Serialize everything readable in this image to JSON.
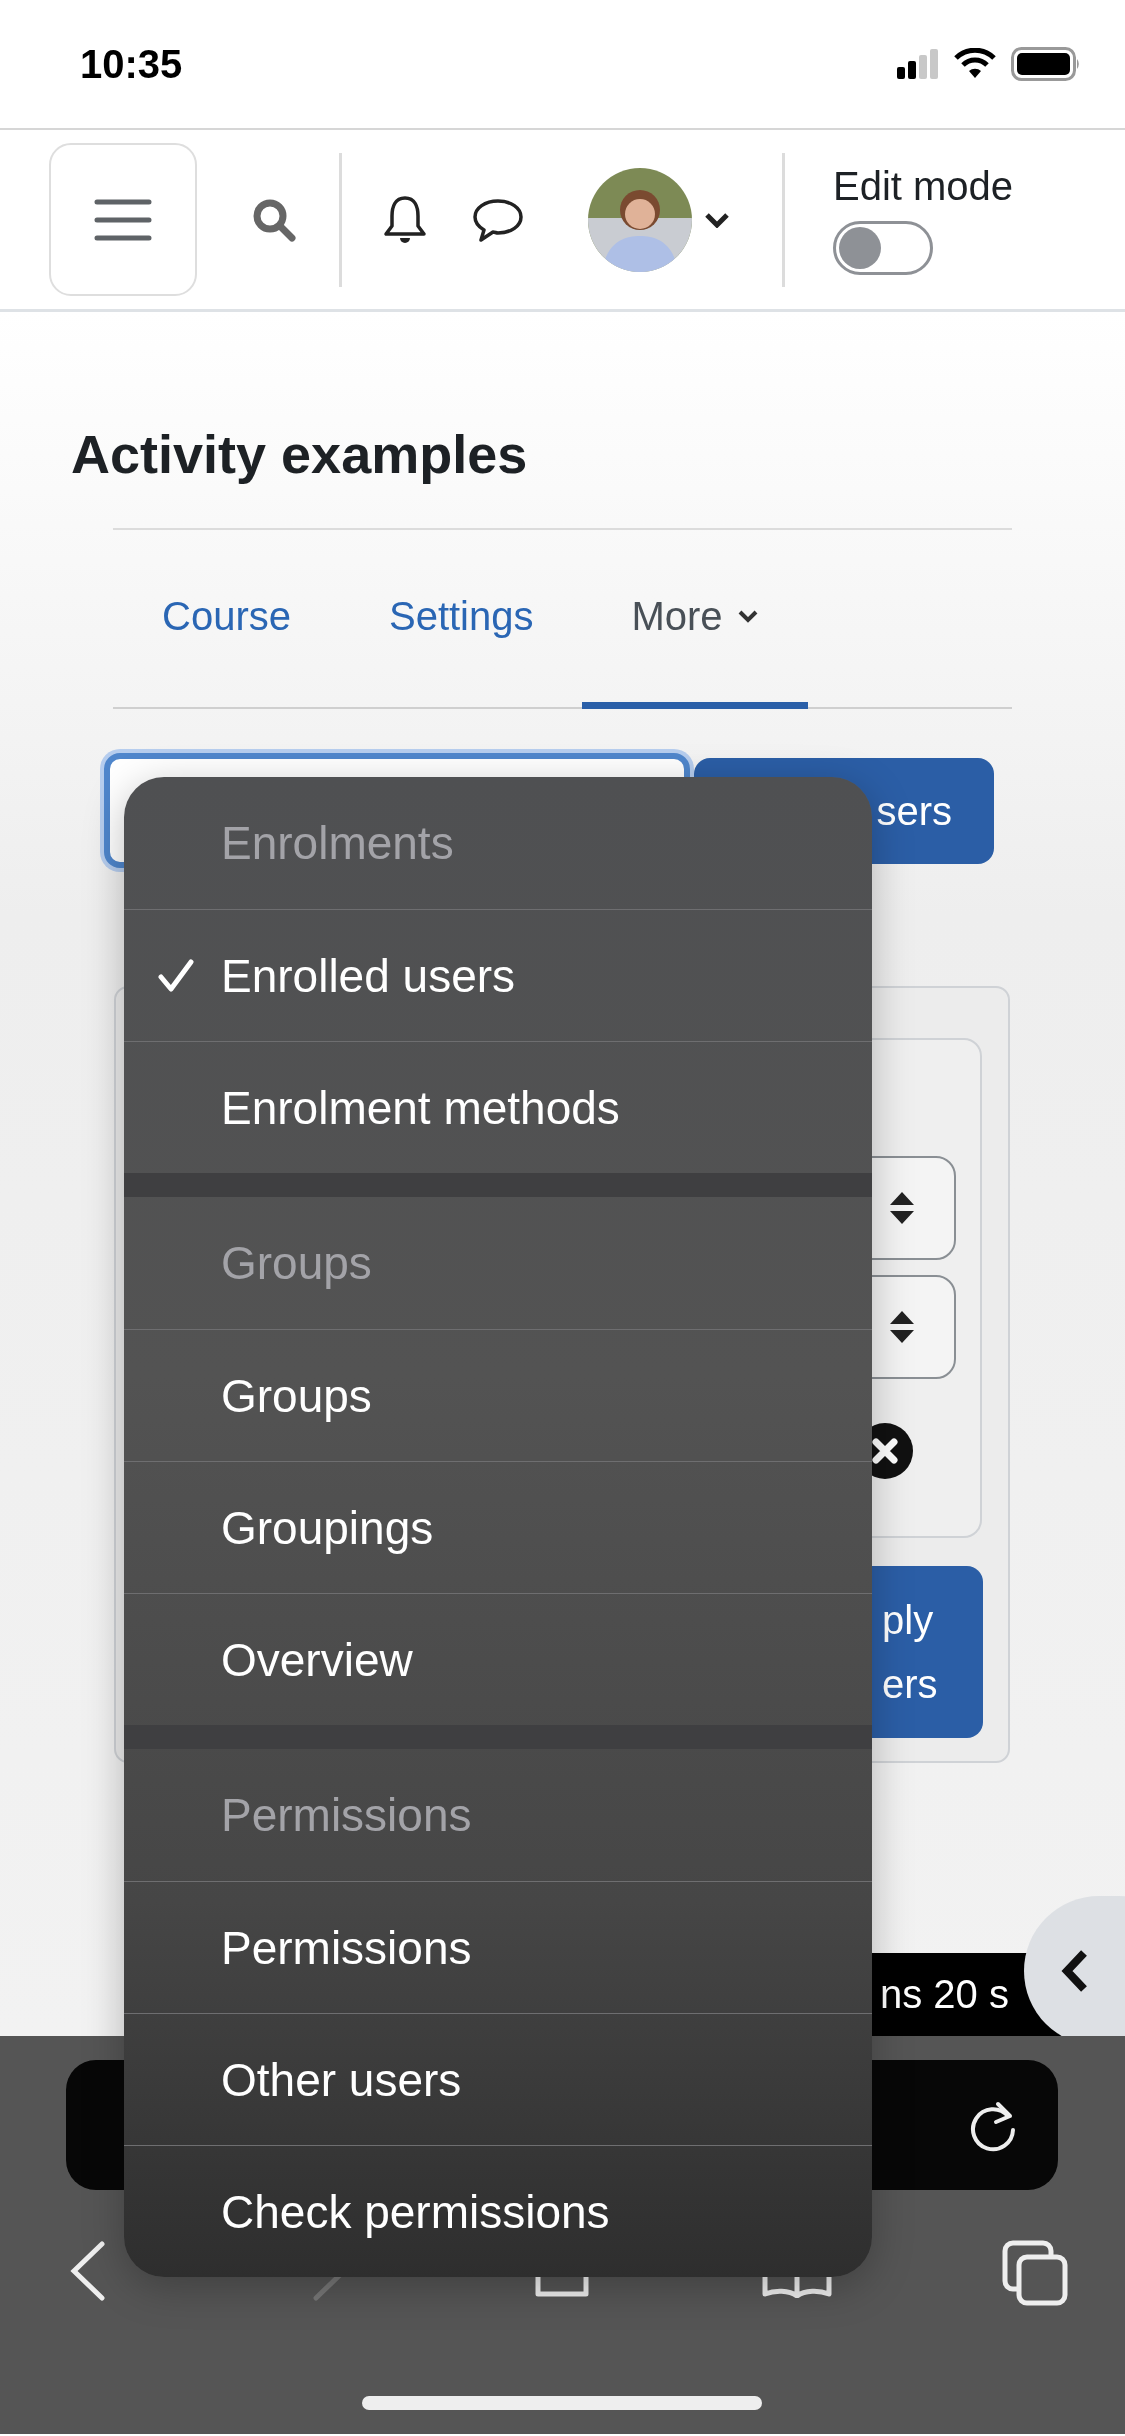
{
  "status_bar": {
    "time": "10:35"
  },
  "header": {
    "edit_mode": {
      "label": "Edit mode",
      "on": false
    }
  },
  "page": {
    "title": "Activity examples",
    "tabs": [
      {
        "label": "Course",
        "kind": "link",
        "selected": false
      },
      {
        "label": "Settings",
        "kind": "link",
        "selected": false
      },
      {
        "label": "More",
        "kind": "dropdown",
        "selected": true
      }
    ]
  },
  "background": {
    "enrol_button": "sers",
    "apply_button": "ply ers",
    "notice": "ns 20 s"
  },
  "select_menu": {
    "groups": [
      {
        "header": "Enrolments",
        "items": [
          {
            "label": "Enrolled users",
            "selected": true
          },
          {
            "label": "Enrolment methods",
            "selected": false
          }
        ]
      },
      {
        "header": "Groups",
        "items": [
          {
            "label": "Groups",
            "selected": false
          },
          {
            "label": "Groupings",
            "selected": false
          },
          {
            "label": "Overview",
            "selected": false
          }
        ]
      },
      {
        "header": "Permissions",
        "items": [
          {
            "label": "Permissions",
            "selected": false
          },
          {
            "label": "Other users",
            "selected": false
          },
          {
            "label": "Check permissions",
            "selected": false
          }
        ]
      }
    ]
  }
}
